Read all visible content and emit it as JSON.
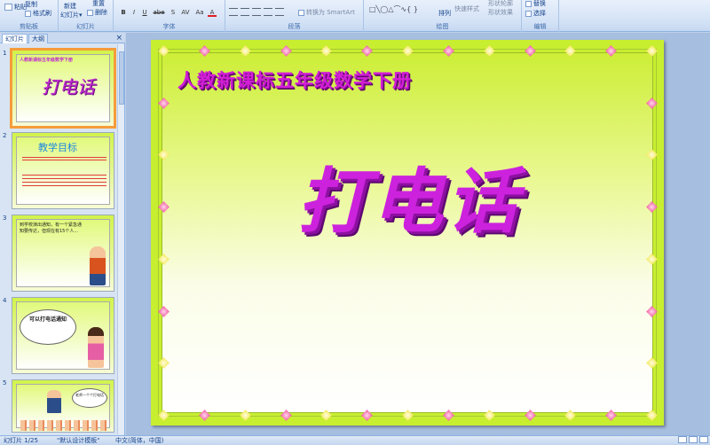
{
  "ribbon": {
    "clipboard": {
      "paste": "粘贴",
      "copy": "复制",
      "format_painter": "格式刷",
      "label": "剪贴板"
    },
    "slides": {
      "new_slide": "新建",
      "new_slide_2": "幻灯片▾",
      "reset": "重置",
      "delete": "删除",
      "label": "幻灯片"
    },
    "font": {
      "bold": "B",
      "italic": "I",
      "underline": "U",
      "strike": "abe",
      "shadow": "S",
      "spacing": "AV",
      "case": "Aa",
      "color": "A",
      "label": "字体"
    },
    "paragraph": {
      "convert_smartart": "转换为 SmartArt",
      "label": "段落"
    },
    "drawing": {
      "arrange": "排列",
      "quick_styles": "快速样式",
      "shape_fill": "形状轮廓",
      "shape_effects": "形状效果",
      "label": "绘图"
    },
    "editing": {
      "replace": "替换",
      "select": "选择",
      "label": "编辑"
    }
  },
  "left_pane": {
    "tab_slides": "幻灯片",
    "tab_outline": "大纲",
    "close": "×",
    "thumbs": [
      {
        "num": "1",
        "title": "打电话",
        "subtitle": "人教新课标五年级数学下册"
      },
      {
        "num": "2",
        "title": "教学目标",
        "text": "1.同学们在动脑思考后中的问题"
      },
      {
        "num": "3",
        "text": "到学校演出通知，有一个紧急通知要传达，但现在有15个人..."
      },
      {
        "num": "4",
        "text": "可以打电话通知"
      },
      {
        "num": "5",
        "text": "老师一个个打电话"
      }
    ]
  },
  "slide": {
    "subtitle": "人教新课标五年级数学下册",
    "title": "打电话"
  },
  "status": {
    "slide_info": "幻灯片 1/25",
    "theme": "\"默认设计模板\"",
    "language": "中文(简体，中国)"
  }
}
